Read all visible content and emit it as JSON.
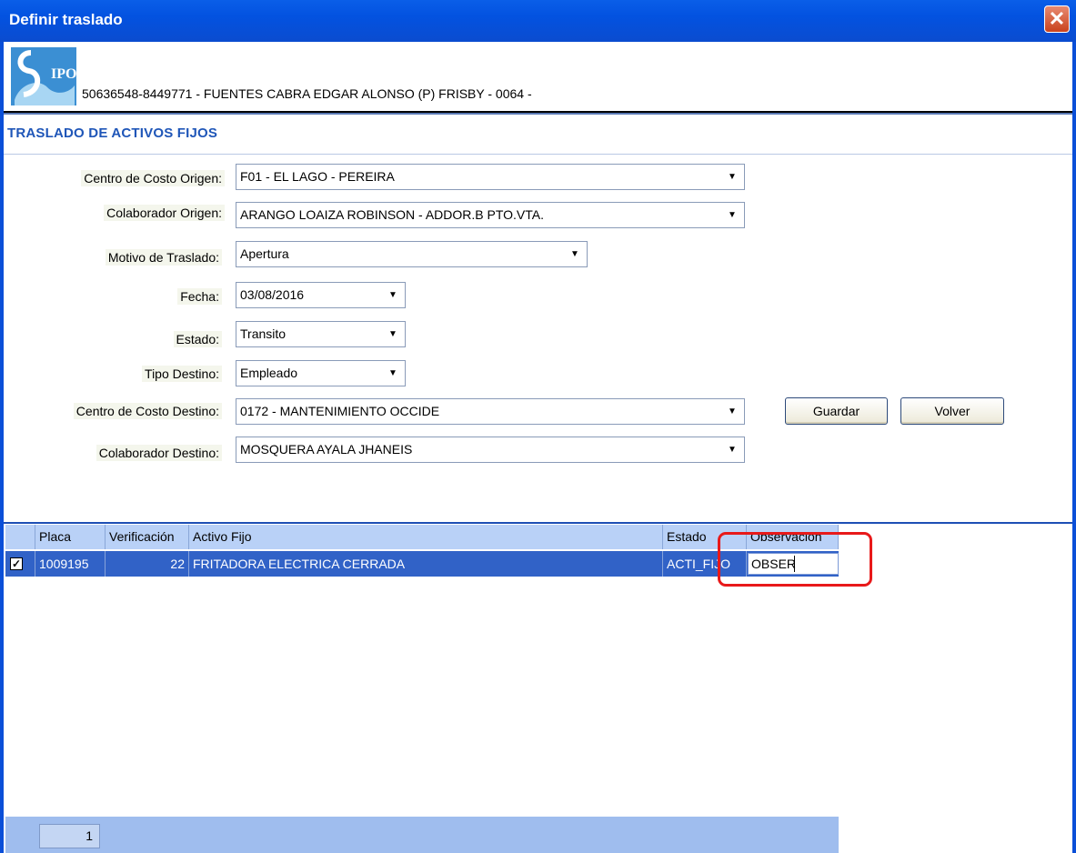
{
  "window": {
    "title": "Definir traslado",
    "close_symbol": "✕"
  },
  "header": {
    "logo_text": "IPO",
    "info": "50636548-8449771 - FUENTES CABRA EDGAR ALONSO (P)  FRISBY - 0064 -"
  },
  "section_title": "TRASLADO DE ACTIVOS FIJOS",
  "form": {
    "centro_origen": {
      "label": "Centro de Costo Origen:",
      "value": "F01 - EL LAGO - PEREIRA"
    },
    "colaborador_origen": {
      "label": "Colaborador Origen:",
      "value": "ARANGO LOAIZA ROBINSON  - ADDOR.B PTO.VTA."
    },
    "motivo": {
      "label": "Motivo de Traslado:",
      "value": "Apertura"
    },
    "fecha": {
      "label": "Fecha:",
      "value": "03/08/2016"
    },
    "estado": {
      "label": "Estado:",
      "value": "Transito"
    },
    "tipo_destino": {
      "label": "Tipo Destino:",
      "value": "Empleado"
    },
    "centro_destino": {
      "label": "Centro de Costo Destino:",
      "value": "0172 - MANTENIMIENTO OCCIDE"
    },
    "colaborador_destino": {
      "label": "Colaborador Destino:",
      "value": "MOSQUERA AYALA JHANEIS"
    }
  },
  "buttons": {
    "guardar": "Guardar",
    "volver": "Volver"
  },
  "grid": {
    "columns": [
      "Placa",
      "Verificación",
      "Activo Fijo",
      "Estado",
      "Observacion"
    ],
    "rows": [
      {
        "checked": true,
        "check_symbol": "✓",
        "placa": "1009195",
        "verificacion": "22",
        "activo": "FRITADORA ELECTRICA CERRADA",
        "estado": "ACTI_FIJO",
        "observacion": "OBSER"
      }
    ],
    "page": "1"
  },
  "colors": {
    "title_bar": "#0352e0",
    "selected_row": "#3162c7",
    "highlight": "#e8191a"
  }
}
